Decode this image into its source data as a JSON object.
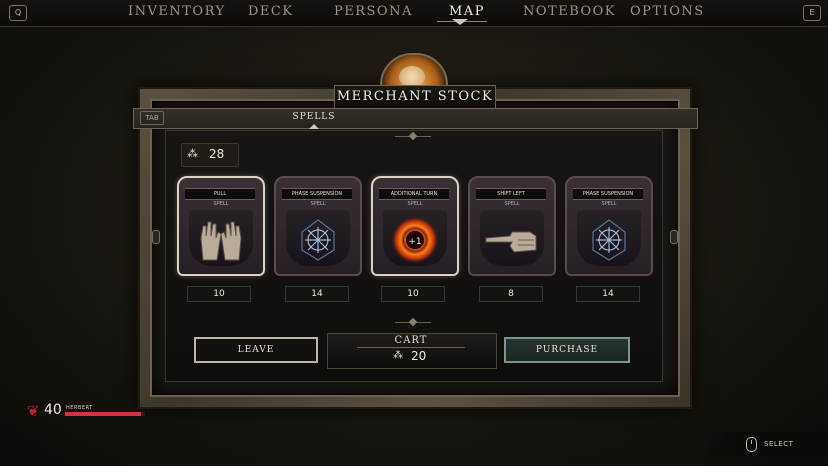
{
  "nav": {
    "left_key": "Q",
    "right_key": "E",
    "items": [
      {
        "label": "INVENTORY",
        "active": false
      },
      {
        "label": "DECK",
        "active": false
      },
      {
        "label": "PERSONA",
        "active": false
      },
      {
        "label": "MAP",
        "active": true
      },
      {
        "label": "NOTEBOOK",
        "active": false
      },
      {
        "label": "OPTIONS",
        "active": false
      }
    ]
  },
  "merchant": {
    "title": "MERCHANT STOCK",
    "tab_key": "TAB",
    "tab_label": "SPELLS",
    "currency_icon": "bone-coin-icon",
    "currency_amount": "28"
  },
  "cards": [
    {
      "name": "PULL",
      "type": "SPELL",
      "art": "open-hands-icon",
      "price": "10",
      "selected": true
    },
    {
      "name": "PHASE SUSPENSION",
      "type": "SPELL",
      "art": "glyph-sigil-icon",
      "price": "14",
      "selected": false
    },
    {
      "name": "ADDITIONAL TURN",
      "type": "SPELL",
      "art": "plus-one-ring-icon",
      "art_text": "+1",
      "price": "10",
      "selected": true
    },
    {
      "name": "SHIFT LEFT",
      "type": "SPELL",
      "art": "pointing-hand-icon",
      "price": "8",
      "selected": false
    },
    {
      "name": "PHASE SUSPENSION",
      "type": "SPELL",
      "art": "glyph-sigil-icon",
      "price": "14",
      "selected": false
    }
  ],
  "actions": {
    "leave": "LEAVE",
    "purchase": "PURCHASE",
    "cart_title": "CART",
    "cart_total": "20"
  },
  "player": {
    "name": "HERBERT",
    "health": "40",
    "health_fraction": 0.95
  },
  "hint": {
    "label": "SELECT",
    "icon": "mouse-icon"
  },
  "colors": {
    "health": "#d4333e",
    "accent_text": "#f1ece0"
  }
}
